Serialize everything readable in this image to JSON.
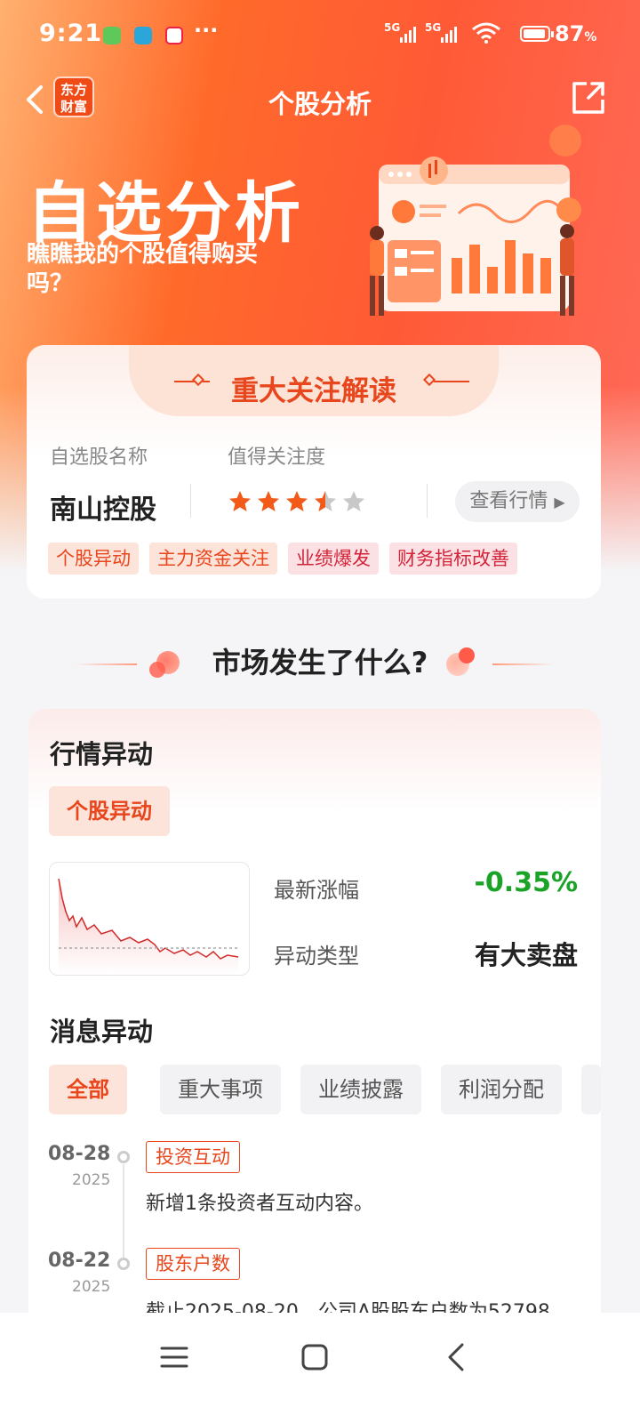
{
  "status_bar": {
    "time": "9:21",
    "more": "···",
    "signal_1": "5G",
    "signal_2": "5G",
    "battery": "87",
    "battery_unit": "%"
  },
  "header": {
    "title": "个股分析",
    "logo_line1": "东方",
    "logo_line2": "财富"
  },
  "banner": {
    "title": "自选分析",
    "subtitle": "瞧瞧我的个股值得购买吗？"
  },
  "focus": {
    "title": "重大关注解读",
    "label_name": "自选股名称",
    "label_attention": "值得关注度",
    "stock_name": "南山控股",
    "rating": 3.5,
    "rating_max": 5,
    "view_button": "查看行情",
    "tags": [
      "个股异动",
      "主力资金关注",
      "业绩爆发",
      "财务指标改善"
    ]
  },
  "section": {
    "heading": "市场发生了什么?"
  },
  "market": {
    "title": "行情异动",
    "chip": "个股异动",
    "latest_change_label": "最新涨幅",
    "latest_change_value": "-0.35%",
    "anomaly_type_label": "异动类型",
    "anomaly_type_value": "有大卖盘",
    "colors": {
      "down": "#1aa326",
      "accent": "#e8461c"
    }
  },
  "news": {
    "title": "消息异动",
    "filters": [
      "全部",
      "重大事项",
      "业绩披露",
      "利润分配"
    ],
    "active_filter": 0,
    "items": [
      {
        "date": "08-28",
        "year": "2025",
        "tag": "投资互动",
        "text": "新增1条投资者互动内容。"
      },
      {
        "date": "08-22",
        "year": "2025",
        "tag": "股东户数",
        "text": "截止2025-08-20，公司A股股东户数为52798"
      }
    ]
  }
}
